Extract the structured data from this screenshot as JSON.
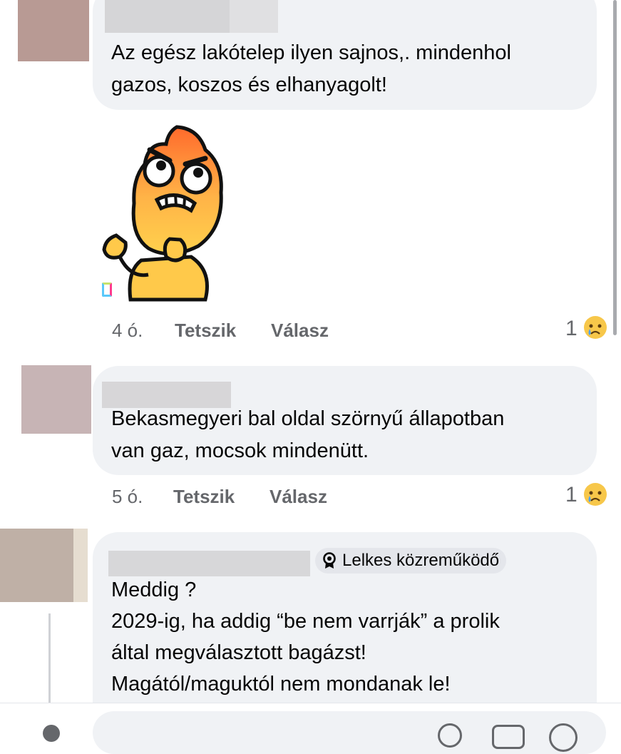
{
  "comments": [
    {
      "text_lines": [
        "Az egész lakótelep ilyen sajnos,. mindenhol",
        "gazos, koszos és elhanyagolt!"
      ],
      "time": "4 ó.",
      "like": "Tetszik",
      "reply": "Válasz",
      "reaction_count": "1",
      "reaction_icon": "sad-face-emoji"
    },
    {
      "text_lines": [
        "Bekasmegyeri bal oldal szörnyű  állapotban",
        "van  gaz,  mocsok mindenütt."
      ],
      "time": "5 ó.",
      "like": "Tetszik",
      "reply": "Válasz",
      "reaction_count": "1",
      "reaction_icon": "sad-face-emoji"
    },
    {
      "badge": "Lelkes közreműködő",
      "badge_icon": "award-icon",
      "text_lines": [
        "Meddig ?",
        "2029-ig, ha addig “be nem varrják” a prolik",
        "által megválasztott bagázst!",
        "Magától/maguktól nem mondanak le!"
      ]
    }
  ],
  "sticker": "angry-fire-sticker",
  "colors": {
    "bubble": "#f0f2f5",
    "meta": "#65676b",
    "text": "#050505"
  }
}
